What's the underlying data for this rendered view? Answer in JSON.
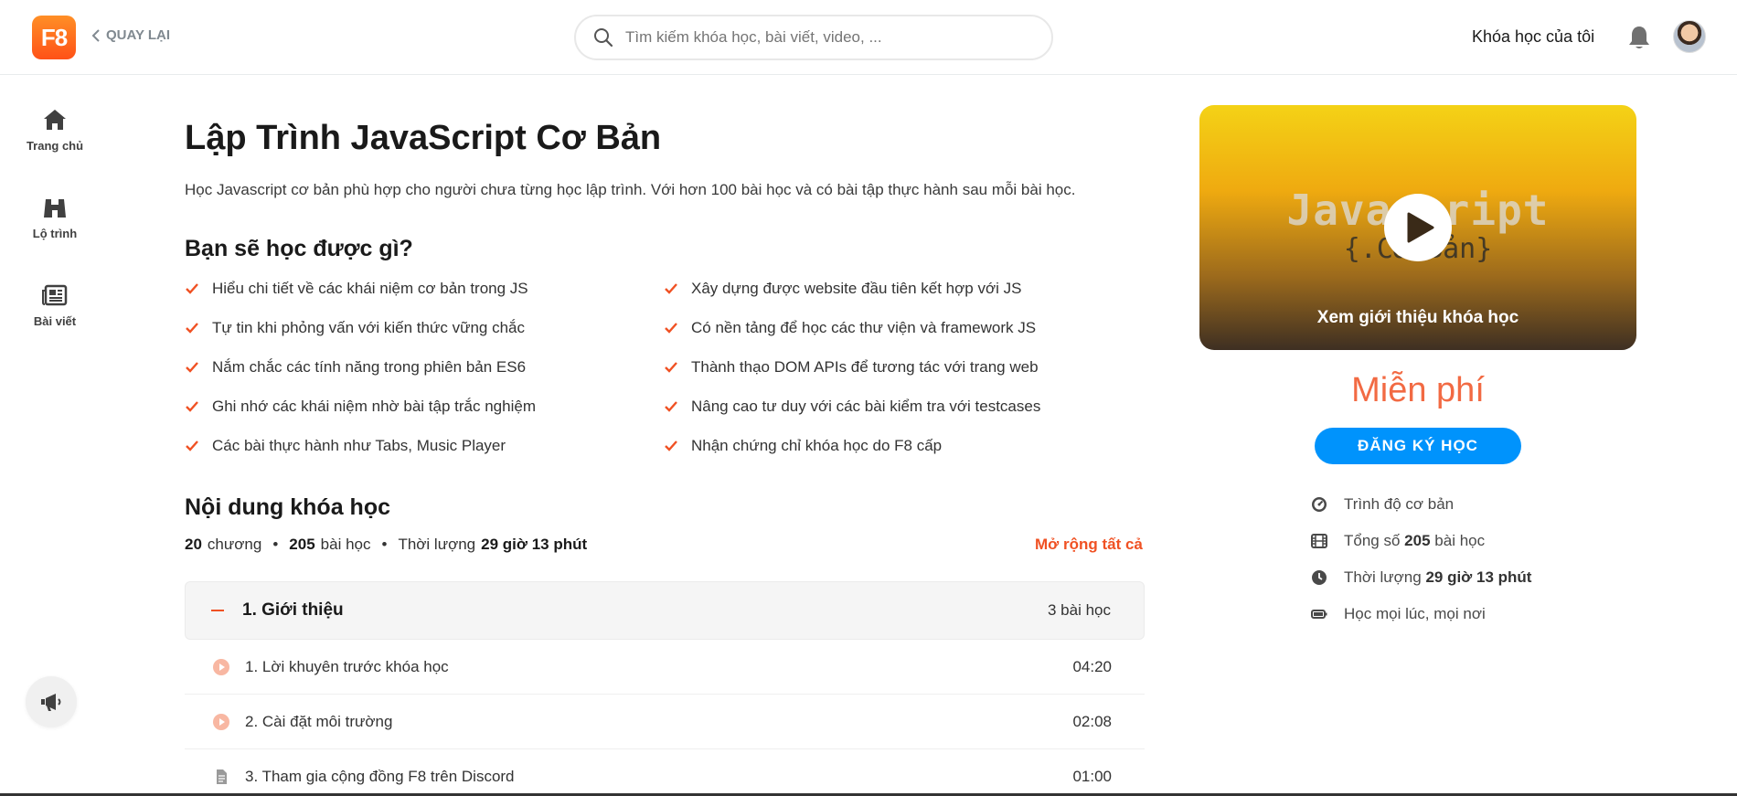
{
  "header": {
    "logo_text": "F8",
    "back_label": "QUAY LẠI",
    "search_placeholder": "Tìm kiếm khóa học, bài viết, video, ...",
    "my_courses_label": "Khóa học của tôi"
  },
  "sidebar": {
    "items": [
      {
        "label": "Trang chủ",
        "icon": "home-icon"
      },
      {
        "label": "Lộ trình",
        "icon": "road-icon"
      },
      {
        "label": "Bài viết",
        "icon": "newspaper-icon"
      }
    ]
  },
  "course": {
    "title": "Lập Trình JavaScript Cơ Bản",
    "description": "Học Javascript cơ bản phù hợp cho người chưa từng học lập trình. Với hơn 100 bài học và có bài tập thực hành sau mỗi bài học.",
    "learn_heading": "Bạn sẽ học được gì?",
    "learn_left": [
      "Hiểu chi tiết về các khái niệm cơ bản trong JS",
      "Tự tin khi phỏng vấn với kiến thức vững chắc",
      "Nắm chắc các tính năng trong phiên bản ES6",
      "Ghi nhớ các khái niệm nhờ bài tập trắc nghiệm",
      "Các bài thực hành như Tabs, Music Player"
    ],
    "learn_right": [
      "Xây dựng được website đầu tiên kết hợp với JS",
      "Có nền tảng để học các thư viện và framework JS",
      "Thành thạo DOM APIs để tương tác với trang web",
      "Nâng cao tư duy với các bài kiểm tra với testcases",
      "Nhận chứng chỉ khóa học do F8 cấp"
    ],
    "content_heading": "Nội dung khóa học",
    "meta": {
      "chapters": "20",
      "chapters_unit": "chương",
      "lessons": "205",
      "lessons_unit": "bài học",
      "duration_label": "Thời lượng",
      "duration": "29 giờ 13 phút",
      "dot": "•"
    },
    "expand_all": "Mở rộng tất cả",
    "chapter": {
      "title": "1. Giới thiệu",
      "count": "3 bài học"
    },
    "lessons_list": [
      {
        "title": "1. Lời khuyên trước khóa học",
        "time": "04:20",
        "type": "video"
      },
      {
        "title": "2. Cài đặt môi trường",
        "time": "02:08",
        "type": "video"
      },
      {
        "title": "3. Tham gia cộng đồng F8 trên Discord",
        "time": "01:00",
        "type": "document"
      }
    ]
  },
  "panel": {
    "preview_title": "Javascript",
    "preview_sub": "{.Cơ Bản}",
    "intro_label": "Xem giới thiệu khóa học",
    "price": "Miễn phí",
    "register_label": "ĐĂNG KÝ HỌC",
    "info": {
      "level": "Trình độ cơ bản",
      "total_prefix": "Tổng số",
      "total_value": "205",
      "total_suffix": "bài học",
      "duration_prefix": "Thời lượng",
      "duration_value": "29 giờ 13 phút",
      "anywhere": "Học mọi lúc, mọi nơi"
    }
  },
  "colors": {
    "accent": "#f05123",
    "primary_button": "#0093fc",
    "text": "#292929"
  }
}
